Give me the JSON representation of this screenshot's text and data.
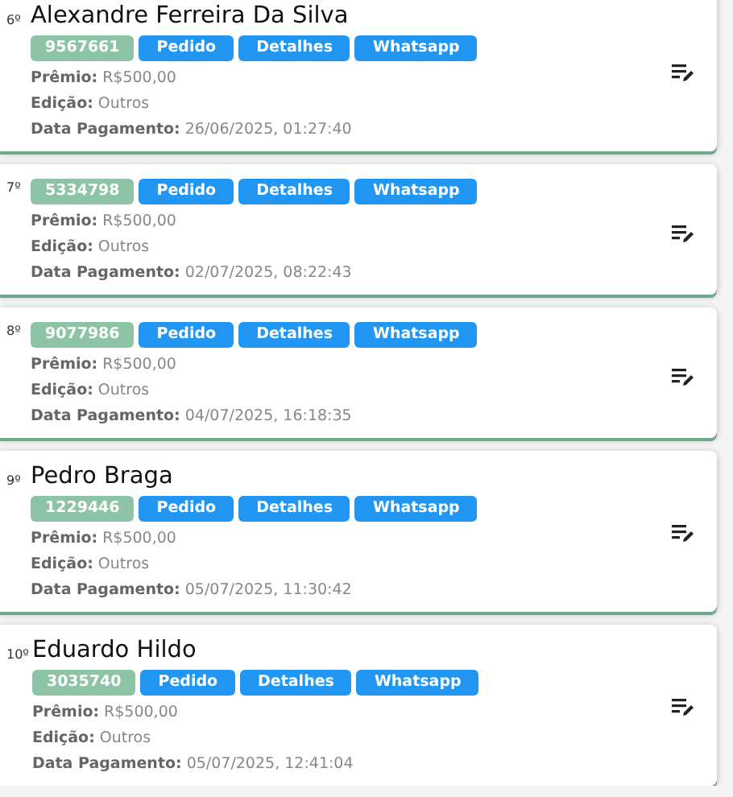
{
  "entries": [
    {
      "rank": "6º",
      "name": "Alexandre Ferreira Da Silva",
      "code": "9567661",
      "buttons": [
        "Pedido",
        "Detalhes",
        "Whatsapp"
      ],
      "fields": [
        {
          "label": "Prêmio:",
          "value": "R$500,00"
        },
        {
          "label": "Edição:",
          "value": "Outros"
        },
        {
          "label": "Data Pagamento:",
          "value": "26/06/2025, 01:27:40"
        }
      ]
    },
    {
      "rank": "7º",
      "code": "5334798",
      "buttons": [
        "Pedido",
        "Detalhes",
        "Whatsapp"
      ],
      "fields": [
        {
          "label": "Prêmio:",
          "value": "R$500,00"
        },
        {
          "label": "Edição:",
          "value": "Outros"
        },
        {
          "label": "Data Pagamento:",
          "value": "02/07/2025, 08:22:43"
        }
      ]
    },
    {
      "rank": "8º",
      "code": "9077986",
      "buttons": [
        "Pedido",
        "Detalhes",
        "Whatsapp"
      ],
      "fields": [
        {
          "label": "Prêmio:",
          "value": "R$500,00"
        },
        {
          "label": "Edição:",
          "value": "Outros"
        },
        {
          "label": "Data Pagamento:",
          "value": "04/07/2025, 16:18:35"
        }
      ]
    },
    {
      "rank": "9º",
      "name": "Pedro Braga",
      "code": "1229446",
      "buttons": [
        "Pedido",
        "Detalhes",
        "Whatsapp"
      ],
      "fields": [
        {
          "label": "Prêmio:",
          "value": "R$500,00"
        },
        {
          "label": "Edição:",
          "value": "Outros"
        },
        {
          "label": "Data Pagamento:",
          "value": "05/07/2025, 11:30:42"
        }
      ]
    },
    {
      "rank": "10º",
      "name": "Eduardo Hildo",
      "code": "3035740",
      "buttons": [
        "Pedido",
        "Detalhes",
        "Whatsapp"
      ],
      "fields": [
        {
          "label": "Prêmio:",
          "value": "R$500,00"
        },
        {
          "label": "Edição:",
          "value": "Outros"
        },
        {
          "label": "Data Pagamento:",
          "value": "05/07/2025, 12:41:04"
        }
      ]
    }
  ]
}
